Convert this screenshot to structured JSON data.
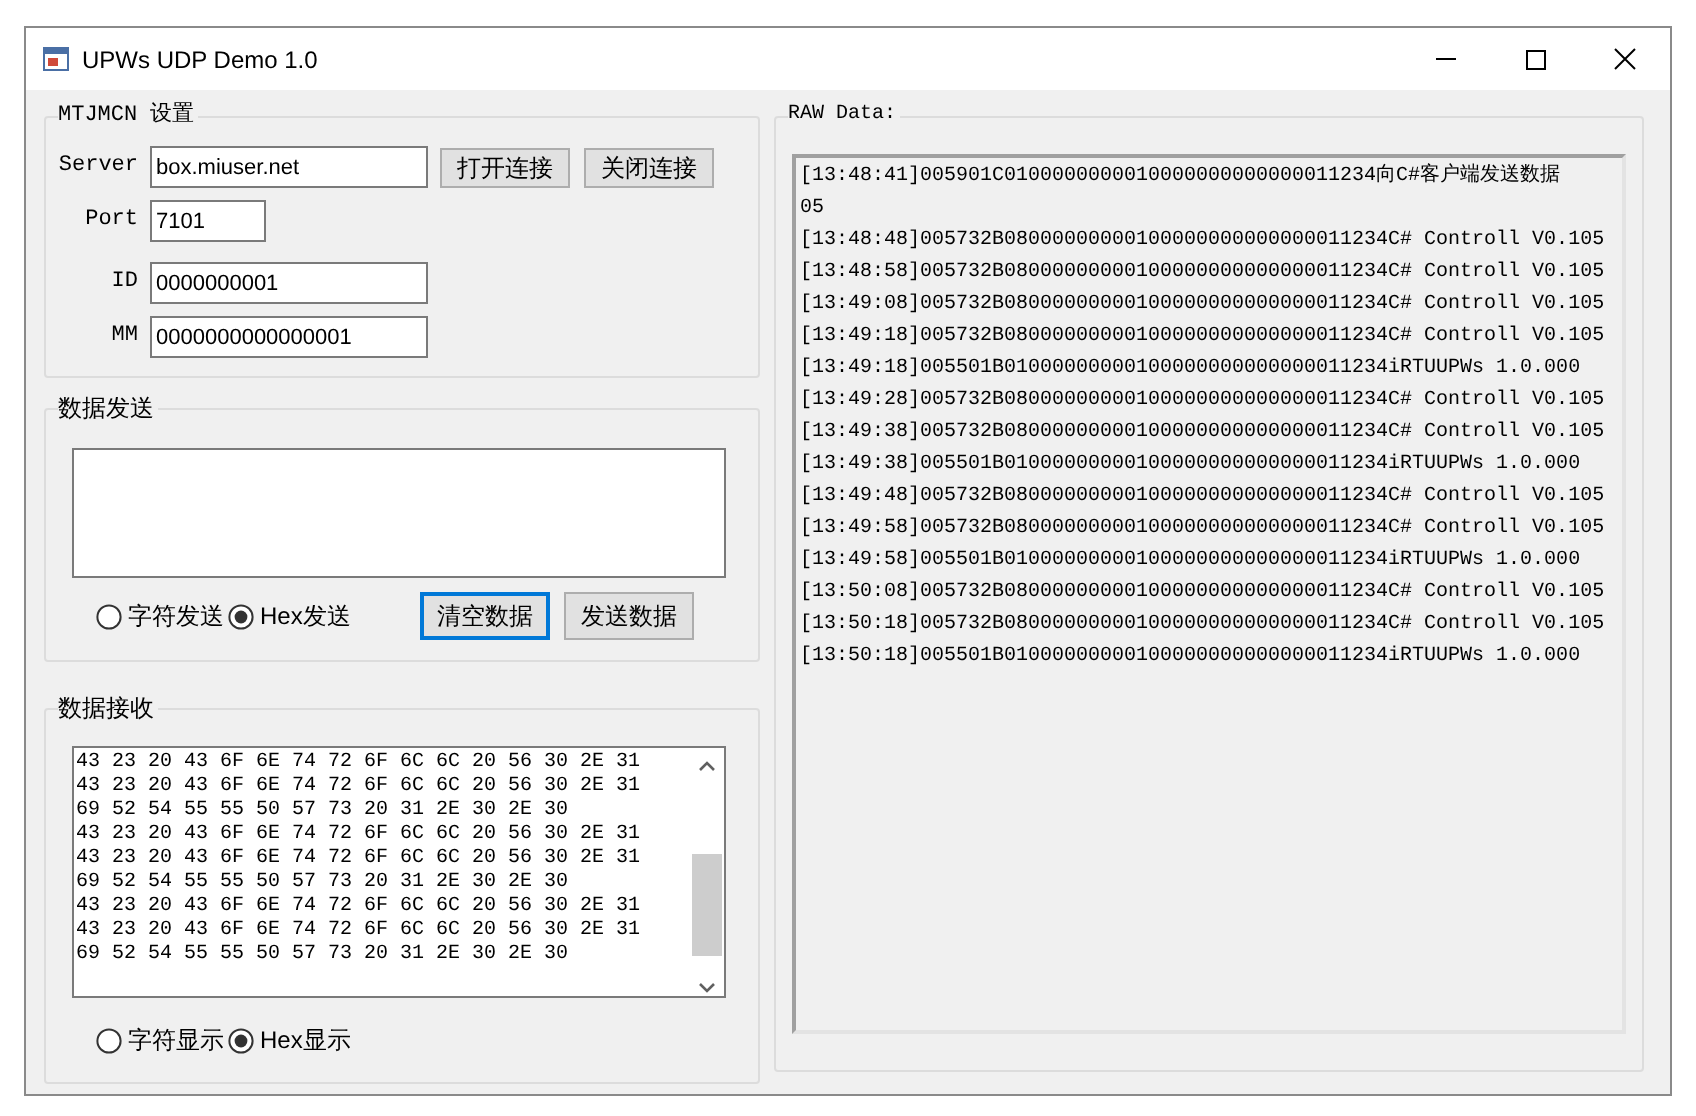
{
  "window": {
    "title": "UPWs UDP Demo 1.0"
  },
  "settings": {
    "title": "MTJMCN 设置",
    "fields": [
      {
        "label": "Server",
        "value": "box.miuser.net"
      },
      {
        "label": "Port",
        "value": "7101"
      },
      {
        "label": "ID",
        "value": "0000000001"
      },
      {
        "label": "MM",
        "value": "0000000000000001"
      }
    ],
    "buttons": [
      {
        "label": "打开连接",
        "focused": false
      },
      {
        "label": "关闭连接",
        "focused": false
      }
    ]
  },
  "send": {
    "title": "数据发送",
    "modes": [
      {
        "label": "字符发送",
        "selected": false
      },
      {
        "label": "Hex发送",
        "selected": true
      }
    ],
    "buttons": [
      {
        "label": "清空数据",
        "focused": true
      },
      {
        "label": "发送数据",
        "focused": false
      }
    ]
  },
  "receive": {
    "title": "数据接收",
    "lines": [
      "43 23 20 43 6F 6E 74 72 6F 6C 6C 20 56 30 2E 31",
      "43 23 20 43 6F 6E 74 72 6F 6C 6C 20 56 30 2E 31",
      "69 52 54 55 55 50 57 73 20 31 2E 30 2E 30",
      "43 23 20 43 6F 6E 74 72 6F 6C 6C 20 56 30 2E 31",
      "43 23 20 43 6F 6E 74 72 6F 6C 6C 20 56 30 2E 31",
      "69 52 54 55 55 50 57 73 20 31 2E 30 2E 30",
      "43 23 20 43 6F 6E 74 72 6F 6C 6C 20 56 30 2E 31",
      "43 23 20 43 6F 6E 74 72 6F 6C 6C 20 56 30 2E 31",
      "69 52 54 55 55 50 57 73 20 31 2E 30 2E 30"
    ],
    "modes": [
      {
        "label": "字符显示",
        "selected": false
      },
      {
        "label": "Hex显示",
        "selected": true
      }
    ]
  },
  "raw": {
    "title": "RAW Data:",
    "lines": [
      "[13:48:41]005901C0100000000010000000000000011234向C#客户端发送数据",
      "05",
      "[13:48:48]005732B08000000000100000000000000011234C# Controll V0.105",
      "[13:48:58]005732B08000000000100000000000000011234C# Controll V0.105",
      "[13:49:08]005732B08000000000100000000000000011234C# Controll V0.105",
      "[13:49:18]005732B08000000000100000000000000011234C# Controll V0.105",
      "[13:49:18]005501B01000000000100000000000000011234iRTUUPWs 1.0.000",
      "[13:49:28]005732B08000000000100000000000000011234C# Controll V0.105",
      "[13:49:38]005732B08000000000100000000000000011234C# Controll V0.105",
      "[13:49:38]005501B01000000000100000000000000011234iRTUUPWs 1.0.000",
      "[13:49:48]005732B08000000000100000000000000011234C# Controll V0.105",
      "[13:49:58]005732B08000000000100000000000000011234C# Controll V0.105",
      "[13:49:58]005501B01000000000100000000000000011234iRTUUPWs 1.0.000",
      "[13:50:08]005732B08000000000100000000000000011234C# Controll V0.105",
      "[13:50:18]005732B08000000000100000000000000011234C# Controll V0.105",
      "[13:50:18]005501B01000000000100000000000000011234iRTUUPWs 1.0.000"
    ]
  }
}
